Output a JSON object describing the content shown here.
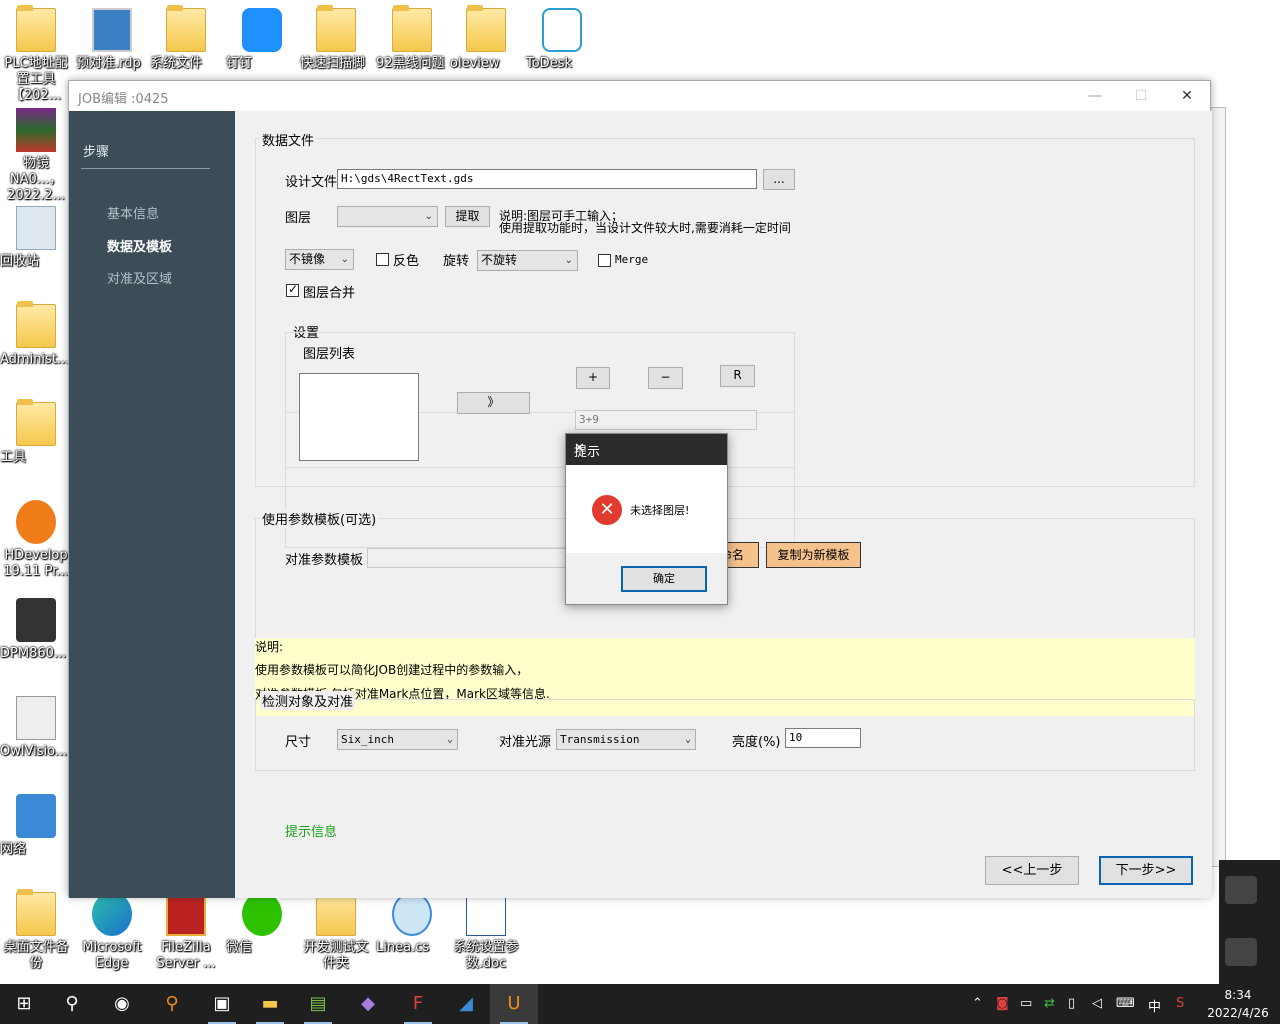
{
  "desktop": {
    "icons_top": [
      {
        "label": "PLC地址配置工具【202..."
      },
      {
        "label": "预对准.rdp"
      },
      {
        "label": "系统文件"
      },
      {
        "label": "钉钉"
      },
      {
        "label": "快速扫描脚"
      },
      {
        "label": "92黑线问题"
      },
      {
        "label": "oleview"
      },
      {
        "label": "ToDesk"
      }
    ],
    "icons_left": [
      {
        "label": "物镜NA0...，2022.2..."
      },
      {
        "label": "回收站"
      },
      {
        "label": "Administ..."
      },
      {
        "label": "工具"
      },
      {
        "label": "HDevelop 19.11 Pr..."
      },
      {
        "label": "DPM860..."
      },
      {
        "label": "OwlVisio..."
      },
      {
        "label": "网络"
      }
    ],
    "icons_bottom": [
      {
        "label": "桌面文件备份"
      },
      {
        "label": "Microsoft Edge"
      },
      {
        "label": "FileZilla Server ..."
      },
      {
        "label": "微信"
      },
      {
        "label": "开发测试文件夹"
      },
      {
        "label": "Linea.cs"
      },
      {
        "label": "系统设置参数.doc"
      }
    ]
  },
  "window": {
    "title": "JOB编辑 :0425",
    "minimize": "—",
    "maximize": "☐",
    "close": "✕"
  },
  "sidebar": {
    "header": "步骤",
    "steps": [
      {
        "label": "基本信息",
        "active": false
      },
      {
        "label": "数据及模板",
        "active": true
      },
      {
        "label": "对准及区域",
        "active": false
      }
    ]
  },
  "data_file": {
    "group_title": "数据文件",
    "design_file_label": "设计文件",
    "design_file_value": "H:\\gds\\4RectText.gds",
    "browse_label": "...",
    "layer_label": "图层",
    "layer_value": "",
    "extract_label": "提取",
    "hint_line1": "说明:图层可手工输入；",
    "hint_line2": "使用提取功能时，当设计文件较大时,需要消耗一定时间",
    "mirror_value": "不镜像",
    "invert_label": "反色",
    "invert_checked": false,
    "rotate_label": "旋转",
    "rotate_value": "不旋转",
    "merge_label": "Merge",
    "merge_checked": false,
    "layer_merge_label": "图层合并",
    "layer_merge_checked": true,
    "settings_title": "设置",
    "layer_list_label": "图层列表",
    "move_label": "》",
    "plus_label": "+",
    "minus_label": "−",
    "r_label": "R",
    "expr_value": "3+9"
  },
  "template": {
    "group_title": "使用参数模板(可选)",
    "align_template_label": "对准参数模板",
    "align_template_value": "",
    "rename_label": "命名",
    "copy_label": "复制为新模板",
    "note_title": "说明:",
    "note_line1": "使用参数模板可以简化JOB创建过程中的参数输入，",
    "note_line2": "对准参数模板  包括对准Mark点位置，Mark区域等信息."
  },
  "detect": {
    "group_title": "检测对象及对准",
    "size_label": "尺寸",
    "size_value": "Six_inch",
    "light_label": "对准光源",
    "light_value": "Transmission",
    "brightness_label": "亮度(%)",
    "brightness_value": "10"
  },
  "footer": {
    "hint_text": "提示信息",
    "prev_label": "<<上一步",
    "next_label": "下一步>>"
  },
  "dialog": {
    "title": "提示",
    "close": "✕",
    "message": "未选择图层!",
    "ok_label": "确定"
  },
  "taskbar": {
    "start": "⊞",
    "search": "⚲",
    "apps": [
      "camera",
      "search-app",
      "remote-desktop",
      "file-explorer",
      "chart-app",
      "visual-studio",
      "filezilla",
      "linea",
      "job-app"
    ],
    "ime": "中",
    "time": "8:34",
    "date": "2022/4/26"
  },
  "colors": {
    "sidebar_bg": "#3c4d58",
    "note_bg": "#ffffcc",
    "hint_green": "#1aa31a",
    "orange_btn": "#f5c28e",
    "error_red": "#e23b2e"
  }
}
